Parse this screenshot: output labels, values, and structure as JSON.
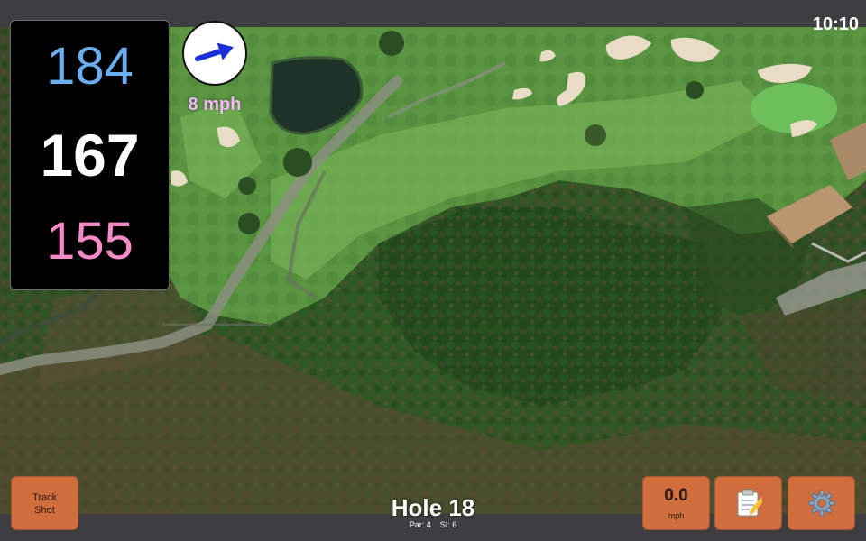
{
  "clock": "10:10",
  "distances": {
    "back": "184",
    "center": "167",
    "front": "155",
    "back_color": "#6aaef0",
    "center_color": "#ffffff",
    "front_color": "#f58ac8"
  },
  "wind": {
    "speed_label": "8 mph",
    "arrow_icon": "wind-direction-arrow-icon",
    "arrow_color": "#1a2fd6",
    "label_color": "#f7b8ff"
  },
  "hole": {
    "title": "Hole 18",
    "par": "Par: 4",
    "stroke_index": "SI: 6"
  },
  "buttons": {
    "track_shot": "Track\nShot",
    "speed_value": "0.0",
    "speed_unit": "mph",
    "notes_icon": "memo-icon",
    "settings_icon": "gear-icon"
  },
  "colors": {
    "button_bg": "#cf6d3d",
    "bar_bg": "#3e3e40"
  }
}
